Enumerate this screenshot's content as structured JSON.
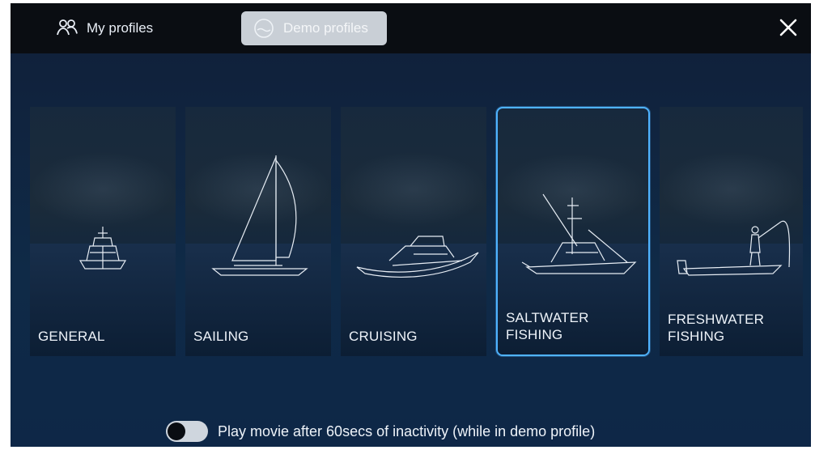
{
  "tabs": {
    "my_profiles": "My profiles",
    "demo_profiles": "Demo profiles"
  },
  "close_icon": "close-icon",
  "cards": [
    {
      "label": "GENERAL",
      "icon": "motor-yacht-icon",
      "selected": false
    },
    {
      "label": "SAILING",
      "icon": "sailboat-icon",
      "selected": false
    },
    {
      "label": "CRUISING",
      "icon": "cruiser-icon",
      "selected": false
    },
    {
      "label": "SALTWATER\nFISHING",
      "icon": "sportfisher-icon",
      "selected": true
    },
    {
      "label": "FRESHWATER\nFISHING",
      "icon": "bass-boat-icon",
      "selected": false
    }
  ],
  "toggle": {
    "label": "Play movie after 60secs of inactivity (while in demo profile)",
    "state": "off"
  },
  "colors": {
    "selection": "#4fb3ff",
    "background": "#0f2a47",
    "topbar": "#0a0d12"
  }
}
